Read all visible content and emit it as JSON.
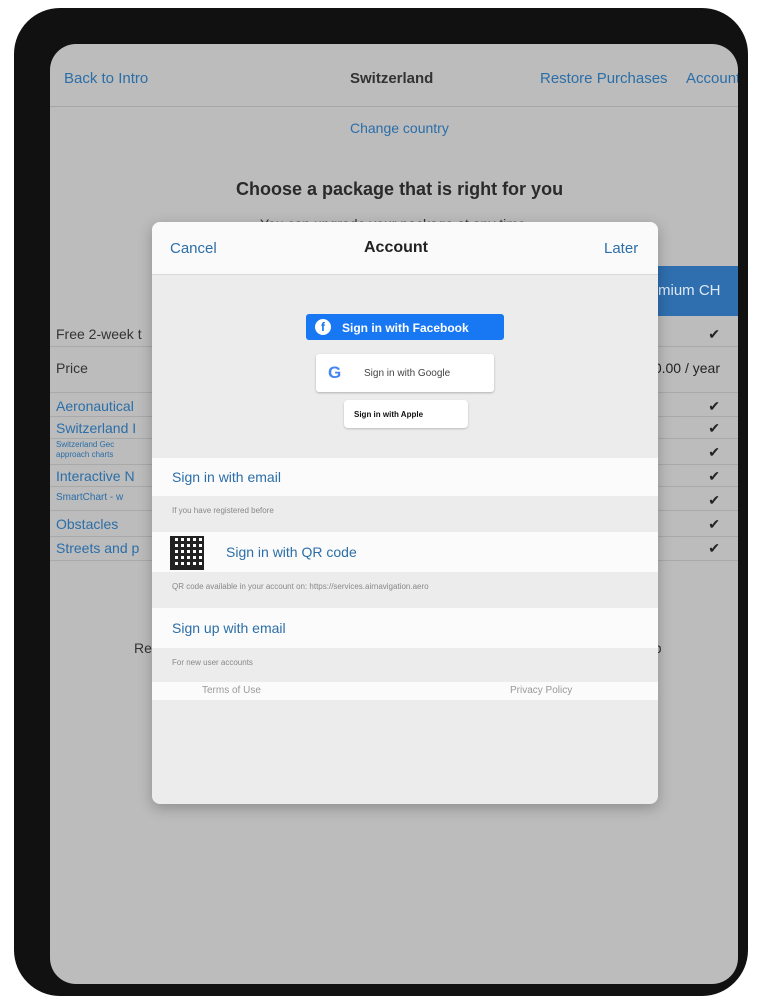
{
  "top_bar": {
    "back": "Back to Intro",
    "title": "Switzerland",
    "restore": "Restore Purchases",
    "account": "Account"
  },
  "change_country": "Change country",
  "headline": "Choose a package that is right for you",
  "subline": "You can upgrade your package at any time",
  "premium_button": "mium CH",
  "rows": [
    {
      "label": "Free 2-week t",
      "value": "✔"
    },
    {
      "label": "Price",
      "value": "90.00 / year"
    },
    {
      "label": "Aeronautical",
      "value": "✔"
    },
    {
      "label": "Switzerland I",
      "value": "✔"
    },
    {
      "label": "Switzerland Gec",
      "label2": "approach charts",
      "value": "✔"
    },
    {
      "label": "Interactive N",
      "value": "✔"
    },
    {
      "label": "SmartChart - w",
      "value": "✔"
    },
    {
      "label": "Obstacles",
      "value": "✔"
    },
    {
      "label": "Streets and p",
      "value": "✔"
    }
  ],
  "bottom_line": {
    "left": "Re",
    "right": "op"
  },
  "modal": {
    "cancel": "Cancel",
    "title": "Account",
    "later": "Later",
    "facebook": "Sign in with Facebook",
    "google": "Sign in with Google",
    "apple": "Sign in with Apple",
    "email_signin": "Sign in with email",
    "email_hint": "If you have registered before",
    "qr_signin": "Sign in with QR code",
    "qr_hint": "QR code available in your account on: https://services.airnavigation.aero",
    "signup": "Sign up with email",
    "signup_hint": "For new user accounts",
    "terms": "Terms of Use",
    "privacy": "Privacy Policy"
  }
}
